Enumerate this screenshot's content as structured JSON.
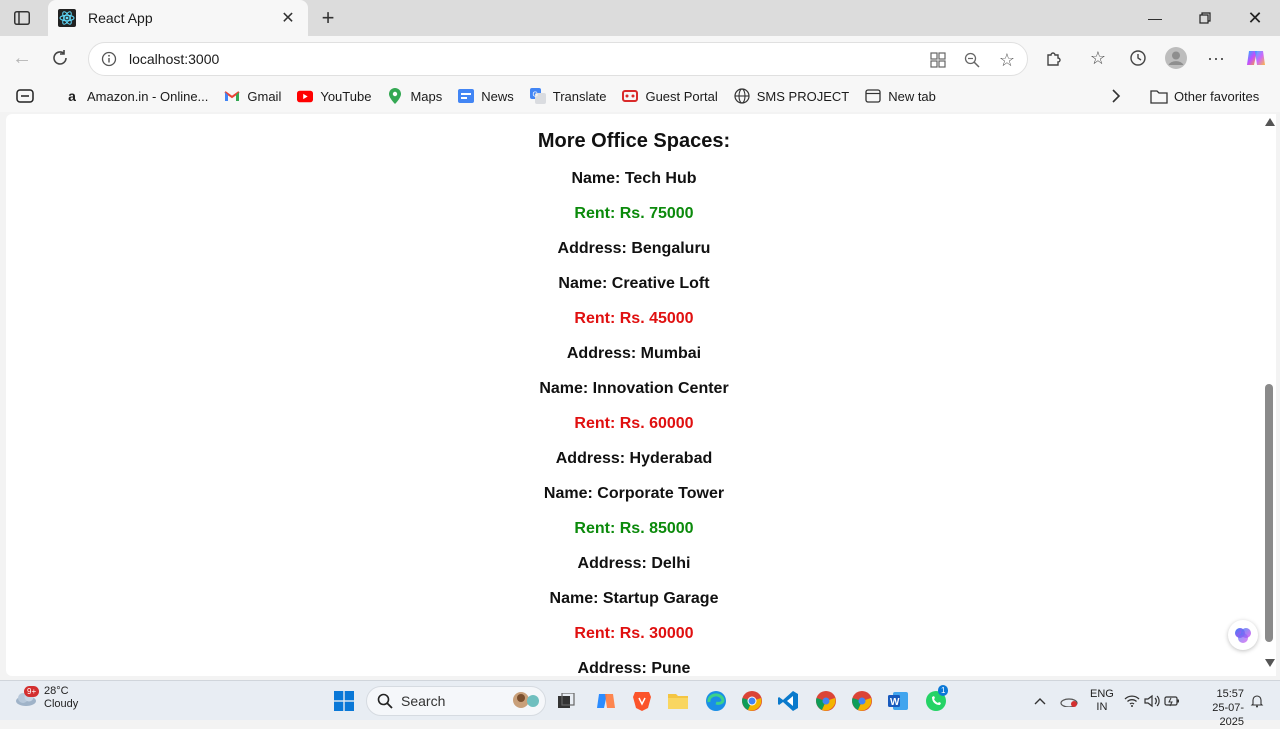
{
  "browser": {
    "tab_title": "React App",
    "url": "localhost:3000",
    "favorites": [
      {
        "label": "Amazon.in - Online..."
      },
      {
        "label": "Gmail"
      },
      {
        "label": "YouTube"
      },
      {
        "label": "Maps"
      },
      {
        "label": "News"
      },
      {
        "label": "Translate"
      },
      {
        "label": "Guest Portal"
      },
      {
        "label": "SMS PROJECT"
      },
      {
        "label": "New tab"
      }
    ],
    "other_favorites": "Other favorites"
  },
  "page": {
    "heading": "More Office Spaces:",
    "offices": [
      {
        "name": "Name: Tech Hub",
        "rent": "Rent: Rs. 75000",
        "rent_color": "green",
        "address": "Address: Bengaluru"
      },
      {
        "name": "Name: Creative Loft",
        "rent": "Rent: Rs. 45000",
        "rent_color": "red",
        "address": "Address: Mumbai"
      },
      {
        "name": "Name: Innovation Center",
        "rent": "Rent: Rs. 60000",
        "rent_color": "red",
        "address": "Address: Hyderabad"
      },
      {
        "name": "Name: Corporate Tower",
        "rent": "Rent: Rs. 85000",
        "rent_color": "green",
        "address": "Address: Delhi"
      },
      {
        "name": "Name: Startup Garage",
        "rent": "Rent: Rs. 30000",
        "rent_color": "red",
        "address": "Address: Pune"
      }
    ],
    "colors": {
      "green": "#0b8a0b",
      "red": "#e01010"
    }
  },
  "taskbar": {
    "weather_temp": "28°C",
    "weather_desc": "Cloudy",
    "weather_badge": "9+",
    "search_label": "Search",
    "lang_line1": "ENG",
    "lang_line2": "IN",
    "time": "15:57",
    "date": "25-07-2025",
    "whatsapp_badge": "1"
  }
}
